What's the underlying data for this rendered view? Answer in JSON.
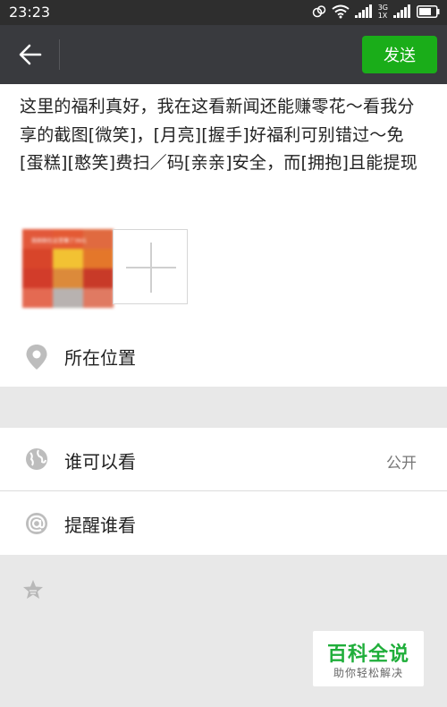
{
  "status_bar": {
    "time": "23:23",
    "network": "3G",
    "signal_label": "1X"
  },
  "toolbar": {
    "send_label": "发送"
  },
  "compose": {
    "text": "这里的福利真好，我在这看新闻还能赚零花～看我分享的截图[微笑]，[月亮][握手]好福利可别错过～免[蛋糕][憨笑]费扫／码[亲亲]安全，而[拥抱]且能提现",
    "thumbnail_caption": "我刚刚在这里赚了39元"
  },
  "location": {
    "label": "所在位置"
  },
  "visibility": {
    "label": "谁可以看",
    "value": "公开"
  },
  "remind": {
    "label": "提醒谁看"
  },
  "watermark": {
    "title": "百科全说",
    "subtitle": "助你轻松解决"
  },
  "colors": {
    "accent_green": "#1aad19",
    "toolbar": "#393a3e",
    "status_bar": "#2e2e2e"
  }
}
